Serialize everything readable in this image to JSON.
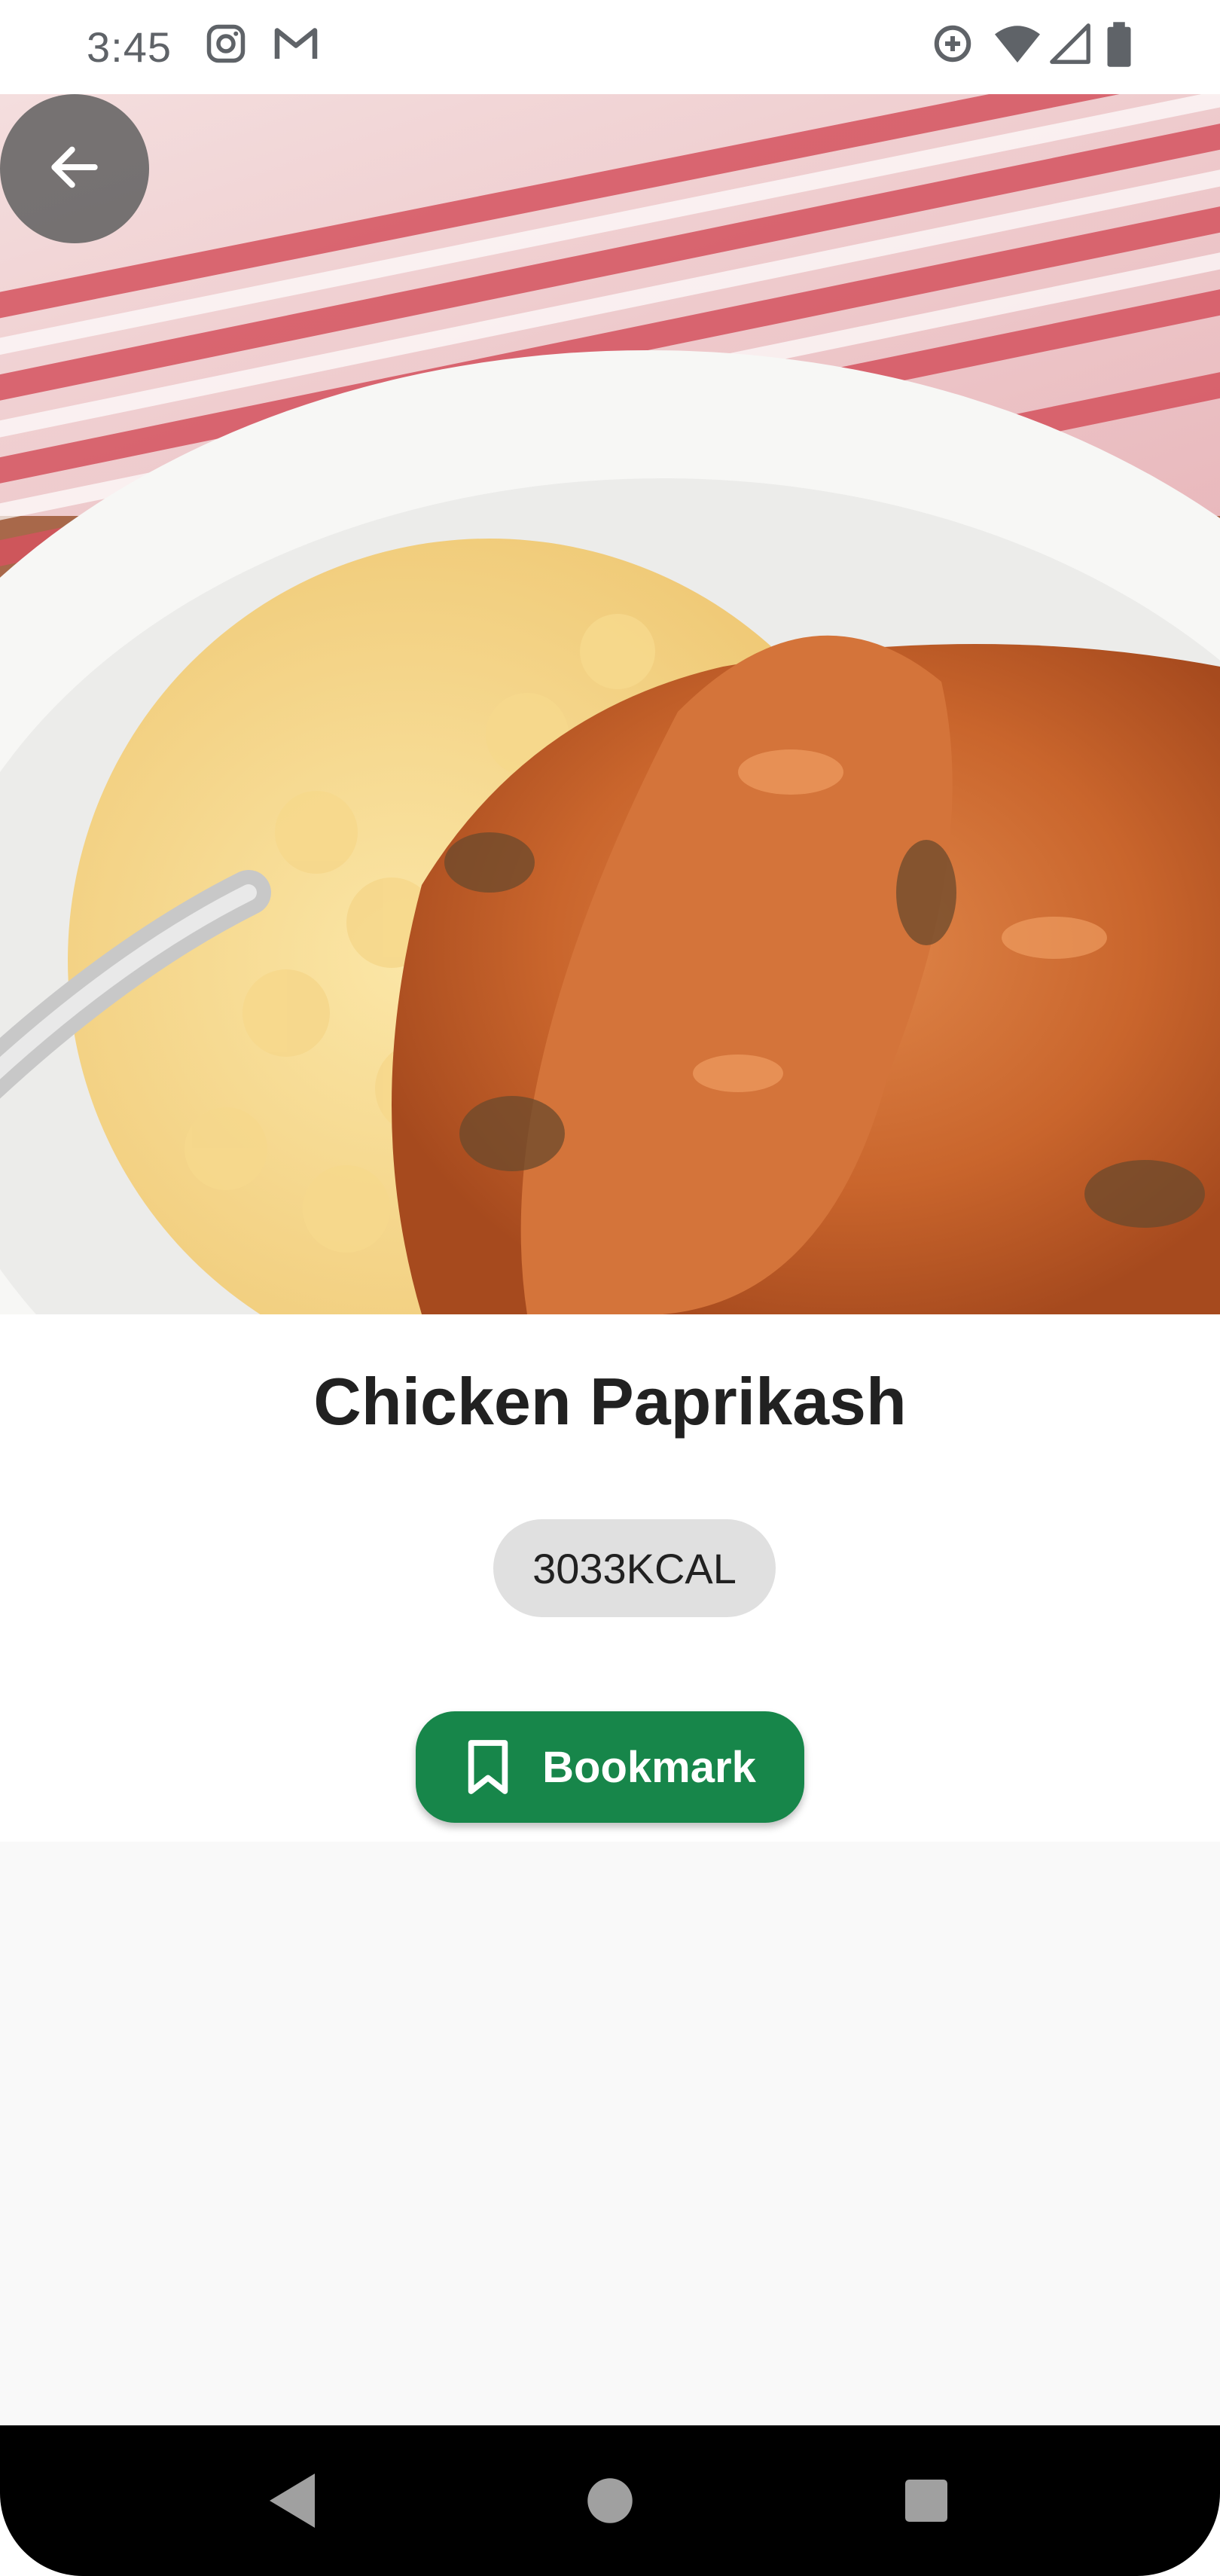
{
  "status_bar": {
    "time": "3:45",
    "left_icons": [
      "instagram-icon",
      "gmail-icon"
    ],
    "right_icons": [
      "sync-icon",
      "wifi-icon",
      "signal-icon",
      "battery-icon"
    ]
  },
  "hero": {
    "image": "chicken-paprikash-photo",
    "back_icon": "arrow-left-icon"
  },
  "recipe": {
    "title": "Chicken Paprikash",
    "calories": "3033KCAL",
    "bookmark_label": "Bookmark",
    "bookmark_icon": "bookmark-outline-icon"
  },
  "colors": {
    "accent": "#17864a",
    "chip_bg": "#e0e0e0",
    "back_button_bg": "#5f5f5f"
  },
  "nav_bar": {
    "buttons": [
      "nav-back-icon",
      "nav-home-icon",
      "nav-recents-icon"
    ]
  }
}
